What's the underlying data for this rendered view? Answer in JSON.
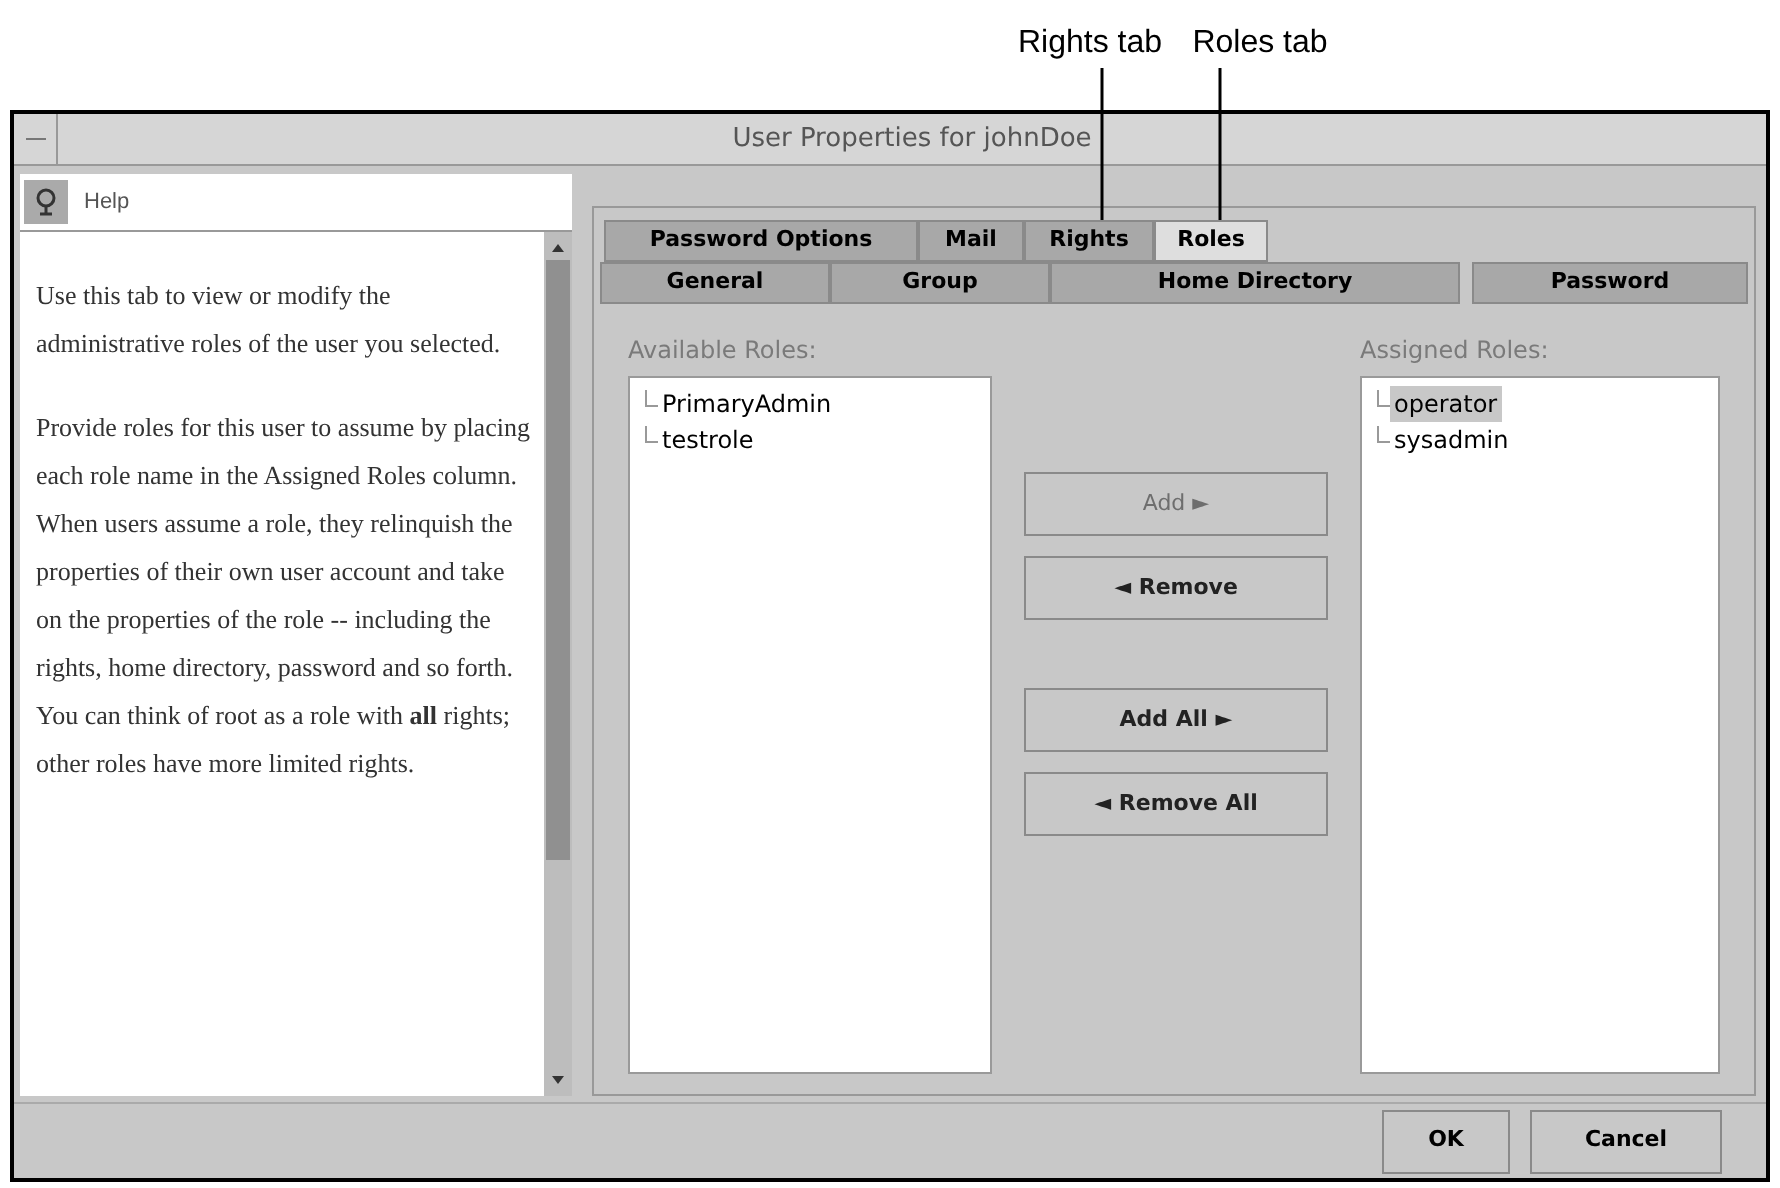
{
  "callouts": [
    "Rights tab",
    "Roles tab"
  ],
  "window": {
    "title": "User Properties for johnDoe"
  },
  "help": {
    "title": "Help",
    "paragraphs": [
      "Use this tab to view or modify the administrative roles of the user you selected.",
      "Provide roles for this user to assume by placing each role name in the Assigned Roles column. When users assume a role, they relinquish the properties of their own user account and take on the properties of the role -- including the rights, home directory, password and so forth. You can think of root as a role with **all** rights; other roles have more limited rights."
    ]
  },
  "tabs_row_1": [
    {
      "label": "Password Options",
      "selected": false
    },
    {
      "label": "Mail",
      "selected": false
    },
    {
      "label": "Rights",
      "selected": false
    },
    {
      "label": "Roles",
      "selected": true
    }
  ],
  "tabs_row_2": [
    {
      "label": "General",
      "selected": false
    },
    {
      "label": "Group",
      "selected": false
    },
    {
      "label": "Home Directory",
      "selected": false
    },
    {
      "label": "Password",
      "selected": false
    }
  ],
  "available_roles": {
    "label": "Available Roles:",
    "items": [
      {
        "name": "PrimaryAdmin",
        "selected": false
      },
      {
        "name": "testrole",
        "selected": false
      }
    ]
  },
  "assigned_roles": {
    "label": "Assigned Roles:",
    "items": [
      {
        "name": "operator",
        "selected": true
      },
      {
        "name": "sysadmin",
        "selected": false
      }
    ]
  },
  "move_buttons": [
    {
      "label": "Add ►",
      "disabled": true
    },
    {
      "label": "◄ Remove",
      "disabled": false
    },
    {
      "label": "Add All ►",
      "disabled": false
    },
    {
      "label": "◄ Remove All",
      "disabled": false
    }
  ],
  "buttons": [
    "OK",
    "Cancel"
  ]
}
